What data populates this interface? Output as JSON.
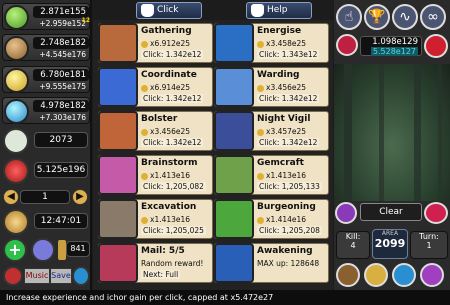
{
  "resources": [
    {
      "main": "2.871e155",
      "sub": "+2.959e152",
      "badge": "12",
      "color": "#7ec850"
    },
    {
      "main": "2.748e182",
      "sub": "+4.545e176",
      "color": "#c0a070"
    },
    {
      "main": "6.780e181",
      "sub": "+9.555e175",
      "color": "#e8d44a"
    },
    {
      "main": "4.978e182",
      "sub": "+7.303e176",
      "color": "#4ac2e8"
    }
  ],
  "stats": {
    "misc_value": "2073",
    "mana": "5.125e196",
    "level_counter": "1",
    "timer": "12:47:01",
    "gems": "841"
  },
  "bottom_buttons": {
    "music": "Music",
    "save": "Save"
  },
  "header": {
    "click_label": "Click",
    "help_label": "Help"
  },
  "cards": [
    {
      "title": "Gathering",
      "line2": "x6.912e25",
      "line3": "Click: 1.342e12",
      "color": "#b86a3c"
    },
    {
      "title": "Energise",
      "line2": "x3.458e25",
      "line3": "Click: 1.343e12",
      "color": "#2a6fc4"
    },
    {
      "title": "Coordinate",
      "line2": "x6.914e25",
      "line3": "Click: 1.342e12",
      "color": "#3c6ad4"
    },
    {
      "title": "Warding",
      "line2": "x3.456e25",
      "line3": "Click: 1.342e12",
      "color": "#5a8fd8"
    },
    {
      "title": "Bolster",
      "line2": "x3.456e25",
      "line3": "Click: 1.342e12",
      "color": "#c0643a"
    },
    {
      "title": "Night Vigil",
      "line2": "x3.457e25",
      "line3": "Click: 1.342e12",
      "color": "#3a4e9a"
    },
    {
      "title": "Brainstorm",
      "line2": "x1.413e16",
      "line3": "Click: 1,205,082",
      "color": "#c45aa8"
    },
    {
      "title": "Gemcraft",
      "line2": "x1.413e16",
      "line3": "Click: 1,205,133",
      "color": "#6fa04a"
    },
    {
      "title": "Excavation",
      "line2": "x1.413e16",
      "line3": "Click: 1,205,025",
      "color": "#8a7a6a"
    },
    {
      "title": "Burgeoning",
      "line2": "x1.414e16",
      "line3": "Click: 1,205,208",
      "color": "#4ca83c"
    },
    {
      "title": "Mail: 5/5",
      "line2": "Random reward!",
      "line3": "Next: Full",
      "color": "#b83a5a"
    },
    {
      "title": "Awakening",
      "line2": "MAX up: 128648",
      "line3": "",
      "color": "#2a5fb8"
    }
  ],
  "right_panel": {
    "currency_main": "1.098e129",
    "currency_sub": "5.528e127",
    "clear_label": "Clear",
    "kill_label": "Kill:",
    "kill_value": "4",
    "area_label": "AREA",
    "area_value": "2099",
    "turn_label": "Turn:",
    "turn_value": "1"
  },
  "footer_text": "Increase experience and ichor gain per click, capped at x5.472e27"
}
